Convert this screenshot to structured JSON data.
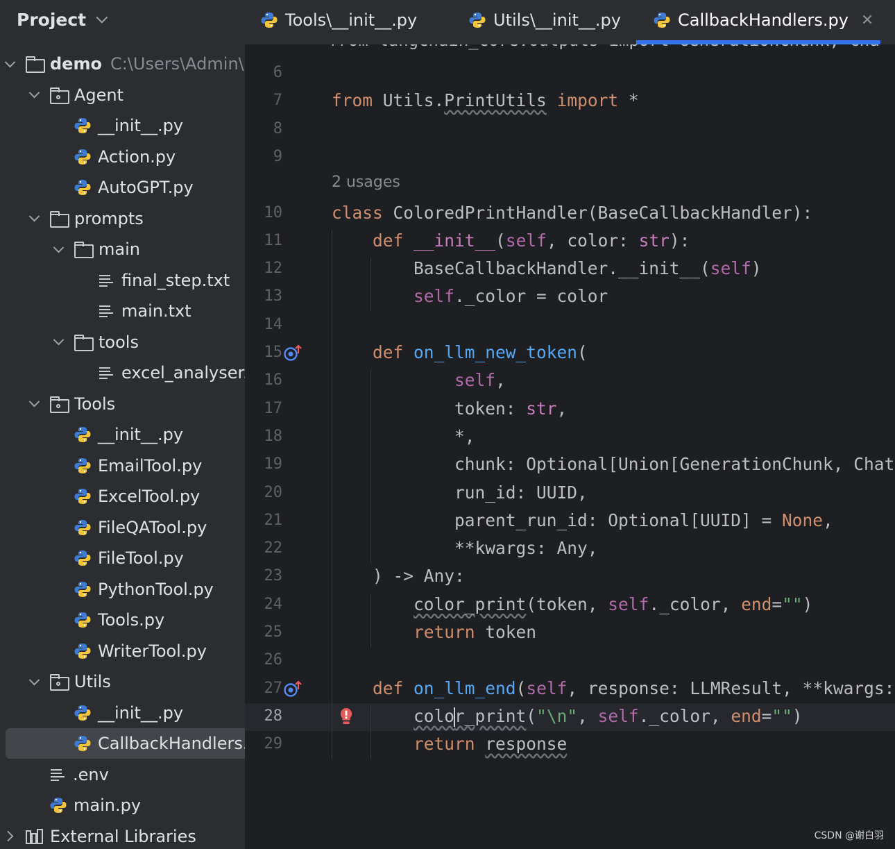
{
  "sidebar": {
    "title": "Project",
    "tree": [
      {
        "kind": "folder",
        "level": 0,
        "expanded": true,
        "label": "demo",
        "desc": "C:\\Users\\Admin\\D"
      },
      {
        "kind": "package",
        "level": 1,
        "expanded": true,
        "label": "Agent"
      },
      {
        "kind": "py",
        "level": 2,
        "label": "__init__.py"
      },
      {
        "kind": "py",
        "level": 2,
        "label": "Action.py"
      },
      {
        "kind": "py",
        "level": 2,
        "label": "AutoGPT.py"
      },
      {
        "kind": "folder",
        "level": 1,
        "expanded": true,
        "label": "prompts"
      },
      {
        "kind": "folder",
        "level": 2,
        "expanded": true,
        "label": "main"
      },
      {
        "kind": "txt",
        "level": 3,
        "label": "final_step.txt"
      },
      {
        "kind": "txt",
        "level": 3,
        "label": "main.txt"
      },
      {
        "kind": "folder",
        "level": 2,
        "expanded": true,
        "label": "tools"
      },
      {
        "kind": "txt",
        "level": 3,
        "label": "excel_analyser.t"
      },
      {
        "kind": "package",
        "level": 1,
        "expanded": true,
        "label": "Tools"
      },
      {
        "kind": "py",
        "level": 2,
        "label": "__init__.py"
      },
      {
        "kind": "py",
        "level": 2,
        "label": "EmailTool.py"
      },
      {
        "kind": "py",
        "level": 2,
        "label": "ExcelTool.py"
      },
      {
        "kind": "py",
        "level": 2,
        "label": "FileQATool.py"
      },
      {
        "kind": "py",
        "level": 2,
        "label": "FileTool.py"
      },
      {
        "kind": "py",
        "level": 2,
        "label": "PythonTool.py"
      },
      {
        "kind": "py",
        "level": 2,
        "label": "Tools.py"
      },
      {
        "kind": "py",
        "level": 2,
        "label": "WriterTool.py"
      },
      {
        "kind": "package",
        "level": 1,
        "expanded": true,
        "label": "Utils"
      },
      {
        "kind": "py",
        "level": 2,
        "label": "__init__.py"
      },
      {
        "kind": "py",
        "level": 2,
        "label": "CallbackHandlers.p",
        "selected": true
      },
      {
        "kind": "txt",
        "level": 1,
        "label": ".env"
      },
      {
        "kind": "py",
        "level": 1,
        "label": "main.py"
      },
      {
        "kind": "lib",
        "level": 0,
        "expanded": false,
        "label": "External Libraries"
      }
    ]
  },
  "tabs": [
    {
      "label": "Tools\\__init__.py",
      "active": false
    },
    {
      "label": "Utils\\__init__.py",
      "active": false
    },
    {
      "label": "CallbackHandlers.py",
      "active": true
    }
  ],
  "editor": {
    "partial_top_line": "from langchain_core.outputs import GenerationChunk, Cha",
    "usages": "2 usages",
    "current_line": 28,
    "lines": [
      {
        "n": "6",
        "tokens": []
      },
      {
        "n": "7",
        "tokens": [
          [
            "k",
            "from "
          ],
          [
            "",
            "Utils."
          ],
          [
            "sq",
            "PrintUtils"
          ],
          [
            "",
            " "
          ],
          [
            "k",
            "import"
          ],
          [
            "",
            " *"
          ]
        ]
      },
      {
        "n": "8",
        "tokens": []
      },
      {
        "n": "9",
        "tokens": []
      },
      {
        "n": "10",
        "tokens": [
          [
            "k",
            "class "
          ],
          [
            "",
            "ColoredPrintHandler(BaseCallbackHandler):"
          ]
        ]
      },
      {
        "n": "11",
        "tokens": [
          [
            "",
            "    "
          ],
          [
            "k",
            "def "
          ],
          [
            "m",
            "__init__"
          ],
          [
            "",
            "("
          ],
          [
            "sl",
            "self"
          ],
          [
            "",
            ", color: "
          ],
          [
            "m",
            "str"
          ],
          [
            "",
            "):"
          ]
        ]
      },
      {
        "n": "12",
        "tokens": [
          [
            "",
            "        BaseCallbackHandler.__init__("
          ],
          [
            "sl",
            "self"
          ],
          [
            "",
            ")"
          ]
        ]
      },
      {
        "n": "13",
        "tokens": [
          [
            "",
            "        "
          ],
          [
            "sl",
            "self"
          ],
          [
            "",
            "._color = color"
          ]
        ]
      },
      {
        "n": "14",
        "tokens": []
      },
      {
        "n": "15",
        "tokens": [
          [
            "",
            "    "
          ],
          [
            "k",
            "def "
          ],
          [
            "f",
            "on_llm_new_token"
          ],
          [
            "",
            "("
          ]
        ]
      },
      {
        "n": "16",
        "tokens": [
          [
            "",
            "            "
          ],
          [
            "sl",
            "self"
          ],
          [
            "",
            ","
          ]
        ]
      },
      {
        "n": "17",
        "tokens": [
          [
            "",
            "            token: "
          ],
          [
            "m",
            "str"
          ],
          [
            "",
            ","
          ]
        ]
      },
      {
        "n": "18",
        "tokens": [
          [
            "",
            "            *,"
          ]
        ]
      },
      {
        "n": "19",
        "tokens": [
          [
            "",
            "            chunk: Optional[Union[GenerationChunk, ChatGenerationChunk]] = "
          ],
          [
            "k",
            "None"
          ],
          [
            "",
            ","
          ]
        ]
      },
      {
        "n": "20",
        "tokens": [
          [
            "",
            "            run_id: UUID,"
          ]
        ]
      },
      {
        "n": "21",
        "tokens": [
          [
            "",
            "            parent_run_id: Optional[UUID] = "
          ],
          [
            "k",
            "None"
          ],
          [
            "",
            ","
          ]
        ]
      },
      {
        "n": "22",
        "tokens": [
          [
            "",
            "            **kwargs: Any,"
          ]
        ]
      },
      {
        "n": "23",
        "tokens": [
          [
            "",
            "    ) -> Any:"
          ]
        ]
      },
      {
        "n": "24",
        "tokens": [
          [
            "",
            "        "
          ],
          [
            "sq",
            "color_print"
          ],
          [
            "",
            "(token, "
          ],
          [
            "sl",
            "self"
          ],
          [
            "",
            "._color, "
          ],
          [
            "k",
            "end"
          ],
          [
            "",
            "="
          ],
          [
            "s",
            "\"\""
          ],
          [
            "",
            ")"
          ]
        ]
      },
      {
        "n": "25",
        "tokens": [
          [
            "",
            "        "
          ],
          [
            "k",
            "return "
          ],
          [
            "",
            "token"
          ]
        ]
      },
      {
        "n": "26",
        "tokens": []
      },
      {
        "n": "27",
        "tokens": [
          [
            "",
            "    "
          ],
          [
            "k",
            "def "
          ],
          [
            "f",
            "on_llm_end"
          ],
          [
            "",
            "("
          ],
          [
            "sl",
            "self"
          ],
          [
            "",
            ", response: LLMResult, **kwargs: Any) -> Any:"
          ]
        ]
      },
      {
        "n": "28",
        "tokens": [
          [
            "",
            "        "
          ],
          [
            "sq",
            "colo"
          ],
          [
            "caret",
            ""
          ],
          [
            "sq",
            "r_print"
          ],
          [
            "",
            "("
          ],
          [
            "s",
            "\"\\n\""
          ],
          [
            "",
            ", "
          ],
          [
            "sl",
            "self"
          ],
          [
            "",
            "._color, "
          ],
          [
            "k",
            "end"
          ],
          [
            "",
            "="
          ],
          [
            "s",
            "\"\""
          ],
          [
            "",
            ")"
          ]
        ]
      },
      {
        "n": "29",
        "tokens": [
          [
            "",
            "        "
          ],
          [
            "k",
            "return "
          ],
          [
            "sq",
            "response"
          ]
        ]
      }
    ]
  },
  "watermark": "CSDN @谢白羽"
}
